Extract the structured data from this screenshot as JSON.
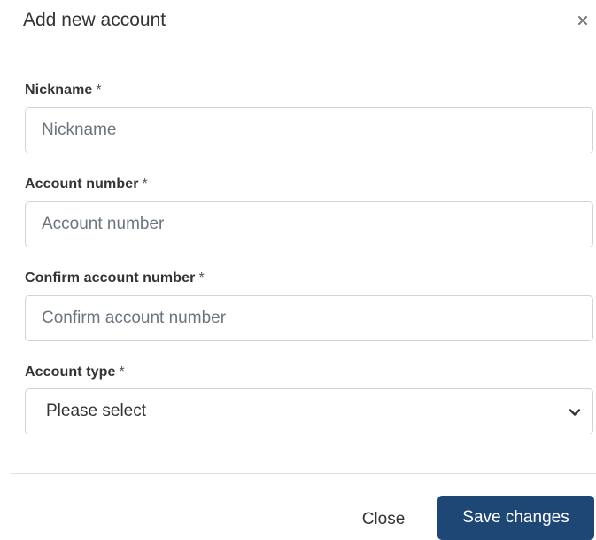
{
  "dialog": {
    "title": "Add new account",
    "close_icon": "close-icon"
  },
  "form": {
    "nickname": {
      "label": "Nickname",
      "required_mark": "*",
      "placeholder": "Nickname",
      "value": ""
    },
    "account_number": {
      "label": "Account number",
      "required_mark": "*",
      "placeholder": "Account number",
      "value": ""
    },
    "confirm_account_number": {
      "label": "Confirm account number",
      "required_mark": "*",
      "placeholder": "Confirm account number",
      "value": ""
    },
    "account_type": {
      "label": "Account type",
      "required_mark": "*",
      "selected": "Please select",
      "icon": "chevron-down-icon"
    }
  },
  "footer": {
    "close_label": "Close",
    "save_label": "Save changes"
  },
  "colors": {
    "primary_button": "#1f4776",
    "border": "#ced4da",
    "divider": "#dee2e6"
  }
}
